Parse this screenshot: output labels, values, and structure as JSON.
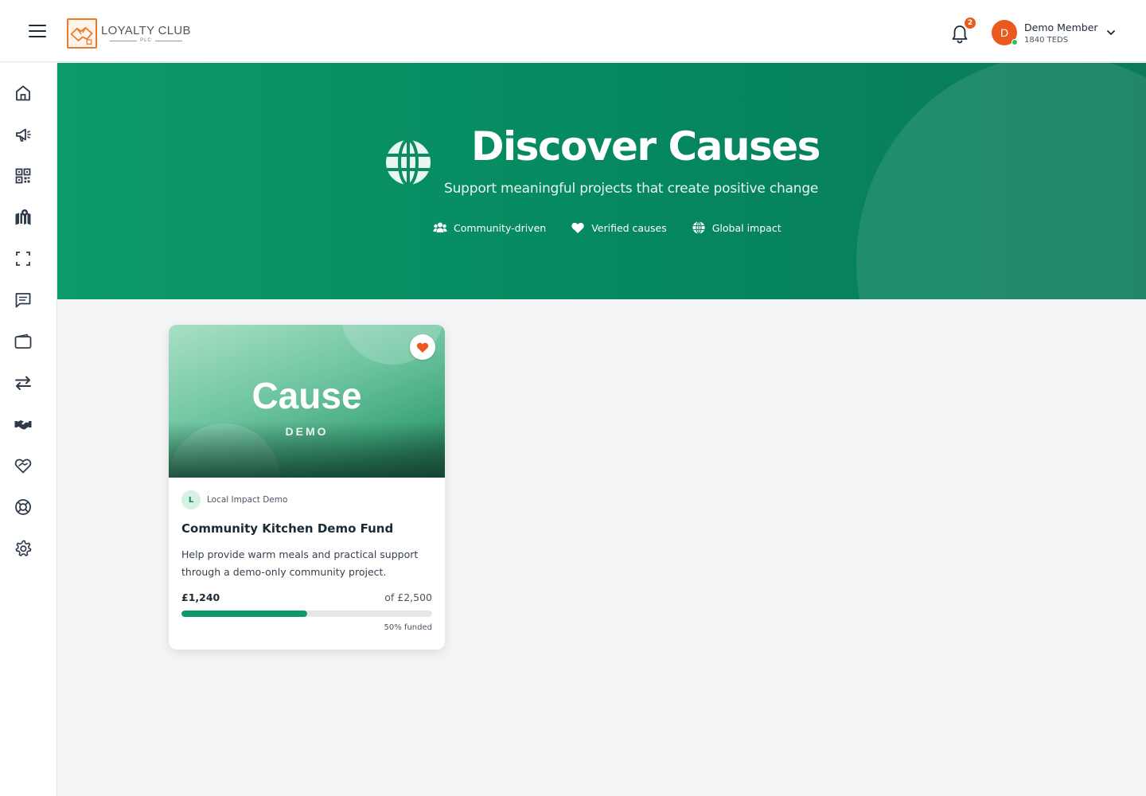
{
  "brand": {
    "title": "LOYALTY CLUB",
    "subtitle": "PLC",
    "accent": "#ea7a2c"
  },
  "header": {
    "notifications": {
      "count": "2",
      "icon": "bell-icon"
    },
    "user": {
      "initial": "D",
      "name": "Demo Member",
      "points": "1840 TEDS",
      "status": "online"
    }
  },
  "sidebar": {
    "items": [
      {
        "icon": "home-icon"
      },
      {
        "icon": "megaphone-icon"
      },
      {
        "icon": "qr-code-icon"
      },
      {
        "icon": "map-icon"
      },
      {
        "icon": "scan-icon"
      },
      {
        "icon": "message-icon"
      },
      {
        "icon": "wallet-icon"
      },
      {
        "icon": "transfer-icon"
      },
      {
        "icon": "handshake-icon"
      },
      {
        "icon": "heart-handshake-icon"
      },
      {
        "icon": "lifebuoy-icon"
      },
      {
        "icon": "settings-icon"
      }
    ]
  },
  "hero": {
    "title": "Discover Causes",
    "subtitle": "Support meaningful projects that create positive change",
    "tags": [
      {
        "icon": "users-icon",
        "label": "Community-driven"
      },
      {
        "icon": "heart-icon",
        "label": "Verified causes"
      },
      {
        "icon": "globe-icon",
        "label": "Global impact"
      }
    ],
    "color": "#0c9a6a"
  },
  "causes": [
    {
      "image_title": "Cause",
      "image_subtitle": "DEMO",
      "org_initial": "L",
      "org_name": "Local Impact Demo",
      "title": "Community Kitchen Demo Fund",
      "description": "Help provide warm meals and practical support through a demo-only community project.",
      "raised": "£1,240",
      "goal": "of £2,500",
      "progress_fraction": 0.5,
      "funded_label": "50% funded",
      "favorited": true
    }
  ]
}
